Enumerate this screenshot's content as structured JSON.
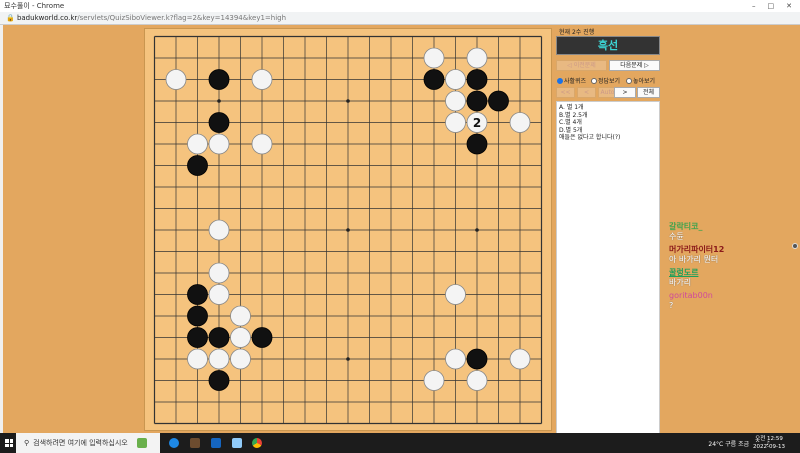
{
  "window": {
    "title": "묘수풀이 - Chrome",
    "url_host": "badukworld.co.kr",
    "url_path": "/servlets/QuizSiboViewer.k?flag=2&key=14394&key1=high"
  },
  "panel": {
    "progress_label": "현재 2수 진행",
    "status": "흑선",
    "prev_button": "◁ 이전문제",
    "next_button": "다음문제 ▷",
    "radios": [
      {
        "label": "사활퀴즈",
        "checked": true
      },
      {
        "label": "정답보기",
        "checked": false
      },
      {
        "label": "놓아보기",
        "checked": false
      }
    ],
    "nav": [
      "<<",
      "<",
      "Auto",
      ">",
      "전체"
    ],
    "answers": [
      "A. 별 1개",
      "B.별 2.5개",
      "C.별 4개",
      "D.별 5개",
      "애들은 없다고 합니다(?)"
    ]
  },
  "board": {
    "size": 19,
    "stones": [
      {
        "c": 13,
        "r": 1,
        "color": "white"
      },
      {
        "c": 15,
        "r": 1,
        "color": "white"
      },
      {
        "c": 1,
        "r": 2,
        "color": "white"
      },
      {
        "c": 3,
        "r": 2,
        "color": "black"
      },
      {
        "c": 5,
        "r": 2,
        "color": "white"
      },
      {
        "c": 13,
        "r": 2,
        "color": "black"
      },
      {
        "c": 14,
        "r": 2,
        "color": "white"
      },
      {
        "c": 15,
        "r": 2,
        "color": "black"
      },
      {
        "c": 14,
        "r": 3,
        "color": "white"
      },
      {
        "c": 15,
        "r": 3,
        "color": "black"
      },
      {
        "c": 16,
        "r": 3,
        "color": "black"
      },
      {
        "c": 3,
        "r": 4,
        "color": "black"
      },
      {
        "c": 14,
        "r": 4,
        "color": "white"
      },
      {
        "c": 15,
        "r": 4,
        "color": "white",
        "label": "2"
      },
      {
        "c": 17,
        "r": 4,
        "color": "white"
      },
      {
        "c": 2,
        "r": 5,
        "color": "white"
      },
      {
        "c": 3,
        "r": 5,
        "color": "white"
      },
      {
        "c": 5,
        "r": 5,
        "color": "white"
      },
      {
        "c": 15,
        "r": 5,
        "color": "black"
      },
      {
        "c": 2,
        "r": 6,
        "color": "black"
      },
      {
        "c": 3,
        "r": 9,
        "color": "white"
      },
      {
        "c": 3,
        "r": 11,
        "color": "white"
      },
      {
        "c": 2,
        "r": 12,
        "color": "black"
      },
      {
        "c": 3,
        "r": 12,
        "color": "white"
      },
      {
        "c": 14,
        "r": 12,
        "color": "white"
      },
      {
        "c": 2,
        "r": 13,
        "color": "black"
      },
      {
        "c": 4,
        "r": 13,
        "color": "white"
      },
      {
        "c": 2,
        "r": 14,
        "color": "black"
      },
      {
        "c": 3,
        "r": 14,
        "color": "black"
      },
      {
        "c": 4,
        "r": 14,
        "color": "white"
      },
      {
        "c": 5,
        "r": 14,
        "color": "black"
      },
      {
        "c": 2,
        "r": 15,
        "color": "white"
      },
      {
        "c": 3,
        "r": 15,
        "color": "white"
      },
      {
        "c": 4,
        "r": 15,
        "color": "white"
      },
      {
        "c": 14,
        "r": 15,
        "color": "white"
      },
      {
        "c": 15,
        "r": 15,
        "color": "black"
      },
      {
        "c": 17,
        "r": 15,
        "color": "white"
      },
      {
        "c": 3,
        "r": 16,
        "color": "black"
      },
      {
        "c": 13,
        "r": 16,
        "color": "white"
      },
      {
        "c": 15,
        "r": 16,
        "color": "white"
      }
    ]
  },
  "chat": [
    {
      "nick": "갈락티코_",
      "msg": "수듄",
      "color": "#3fa34d"
    },
    {
      "nick": "머가리파이터12",
      "msg": "아 바가리 뭔터",
      "color": "#8b1a1a"
    },
    {
      "nick": "꿀렁도르",
      "msg": "바가리",
      "color": "#1fa05a"
    },
    {
      "nick": "goritab00n",
      "msg": "?",
      "color": "#d04a9a"
    }
  ],
  "taskbar": {
    "search_placeholder": "검색하려면 여기에 입력하십시오",
    "weather": "24°C 구름 조금",
    "time": "오전 12:59",
    "date": "2022-09-13"
  }
}
